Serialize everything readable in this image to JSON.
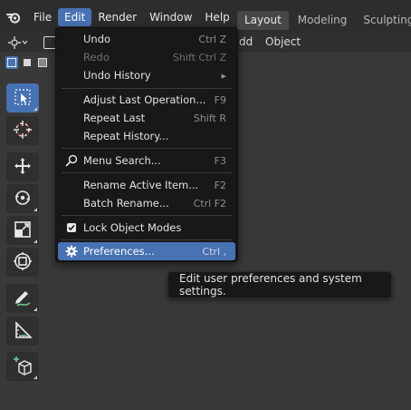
{
  "menubar": {
    "items": [
      "File",
      "Edit",
      "Render",
      "Window",
      "Help"
    ]
  },
  "workspaces": [
    "Layout",
    "Modeling",
    "Sculpting"
  ],
  "header": {
    "add_fragment": "dd",
    "object": "Object"
  },
  "edit_menu": {
    "undo": {
      "label": "Undo",
      "shortcut": "Ctrl Z"
    },
    "redo": {
      "label": "Redo",
      "shortcut": "Shift Ctrl Z"
    },
    "undo_history": {
      "label": "Undo History",
      "arrow": "▸"
    },
    "adjust_last": {
      "label": "Adjust Last Operation...",
      "shortcut": "F9"
    },
    "repeat_last": {
      "label": "Repeat Last",
      "shortcut": "Shift R"
    },
    "repeat_history": {
      "label": "Repeat History..."
    },
    "menu_search": {
      "label": "Menu Search...",
      "shortcut": "F3"
    },
    "rename_active": {
      "label": "Rename Active Item...",
      "shortcut": "F2"
    },
    "batch_rename": {
      "label": "Batch Rename...",
      "shortcut": "Ctrl F2"
    },
    "lock_object_modes": {
      "label": "Lock Object Modes",
      "checked": true
    },
    "preferences": {
      "label": "Preferences...",
      "shortcut": "Ctrl ,"
    }
  },
  "tooltip": {
    "text": "Edit user preferences and system settings."
  },
  "icons": [
    "blender-logo-icon",
    "search-icon",
    "gear-icon",
    "select-box-icon",
    "cursor-icon",
    "move-icon",
    "rotate-icon",
    "scale-icon",
    "transform-icon",
    "annotate-icon",
    "measure-icon",
    "add-cube-icon"
  ],
  "colors": {
    "accent": "#4772b3",
    "menu_bg": "#181818",
    "bar_bg": "#2d2d2d",
    "viewport_bg": "#393939"
  }
}
